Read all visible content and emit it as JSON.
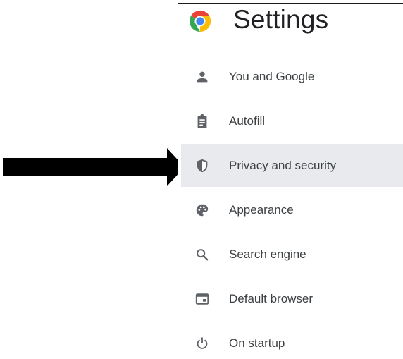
{
  "settings": {
    "title": "Settings",
    "logo_icon": "chrome-logo-icon",
    "nav_items": [
      {
        "label": "You and Google",
        "icon": "person-icon",
        "active": false
      },
      {
        "label": "Autofill",
        "icon": "clipboard-icon",
        "active": false
      },
      {
        "label": "Privacy and security",
        "icon": "shield-icon",
        "active": true
      },
      {
        "label": "Appearance",
        "icon": "palette-icon",
        "active": false
      },
      {
        "label": "Search engine",
        "icon": "search-icon",
        "active": false
      },
      {
        "label": "Default browser",
        "icon": "browser-window-icon",
        "active": false
      },
      {
        "label": "On startup",
        "icon": "power-icon",
        "active": false
      }
    ]
  },
  "colors": {
    "active_background": "#e8eaed",
    "icon_gray": "#5f6368",
    "text": "#3c4043",
    "arrow": "#000000"
  }
}
